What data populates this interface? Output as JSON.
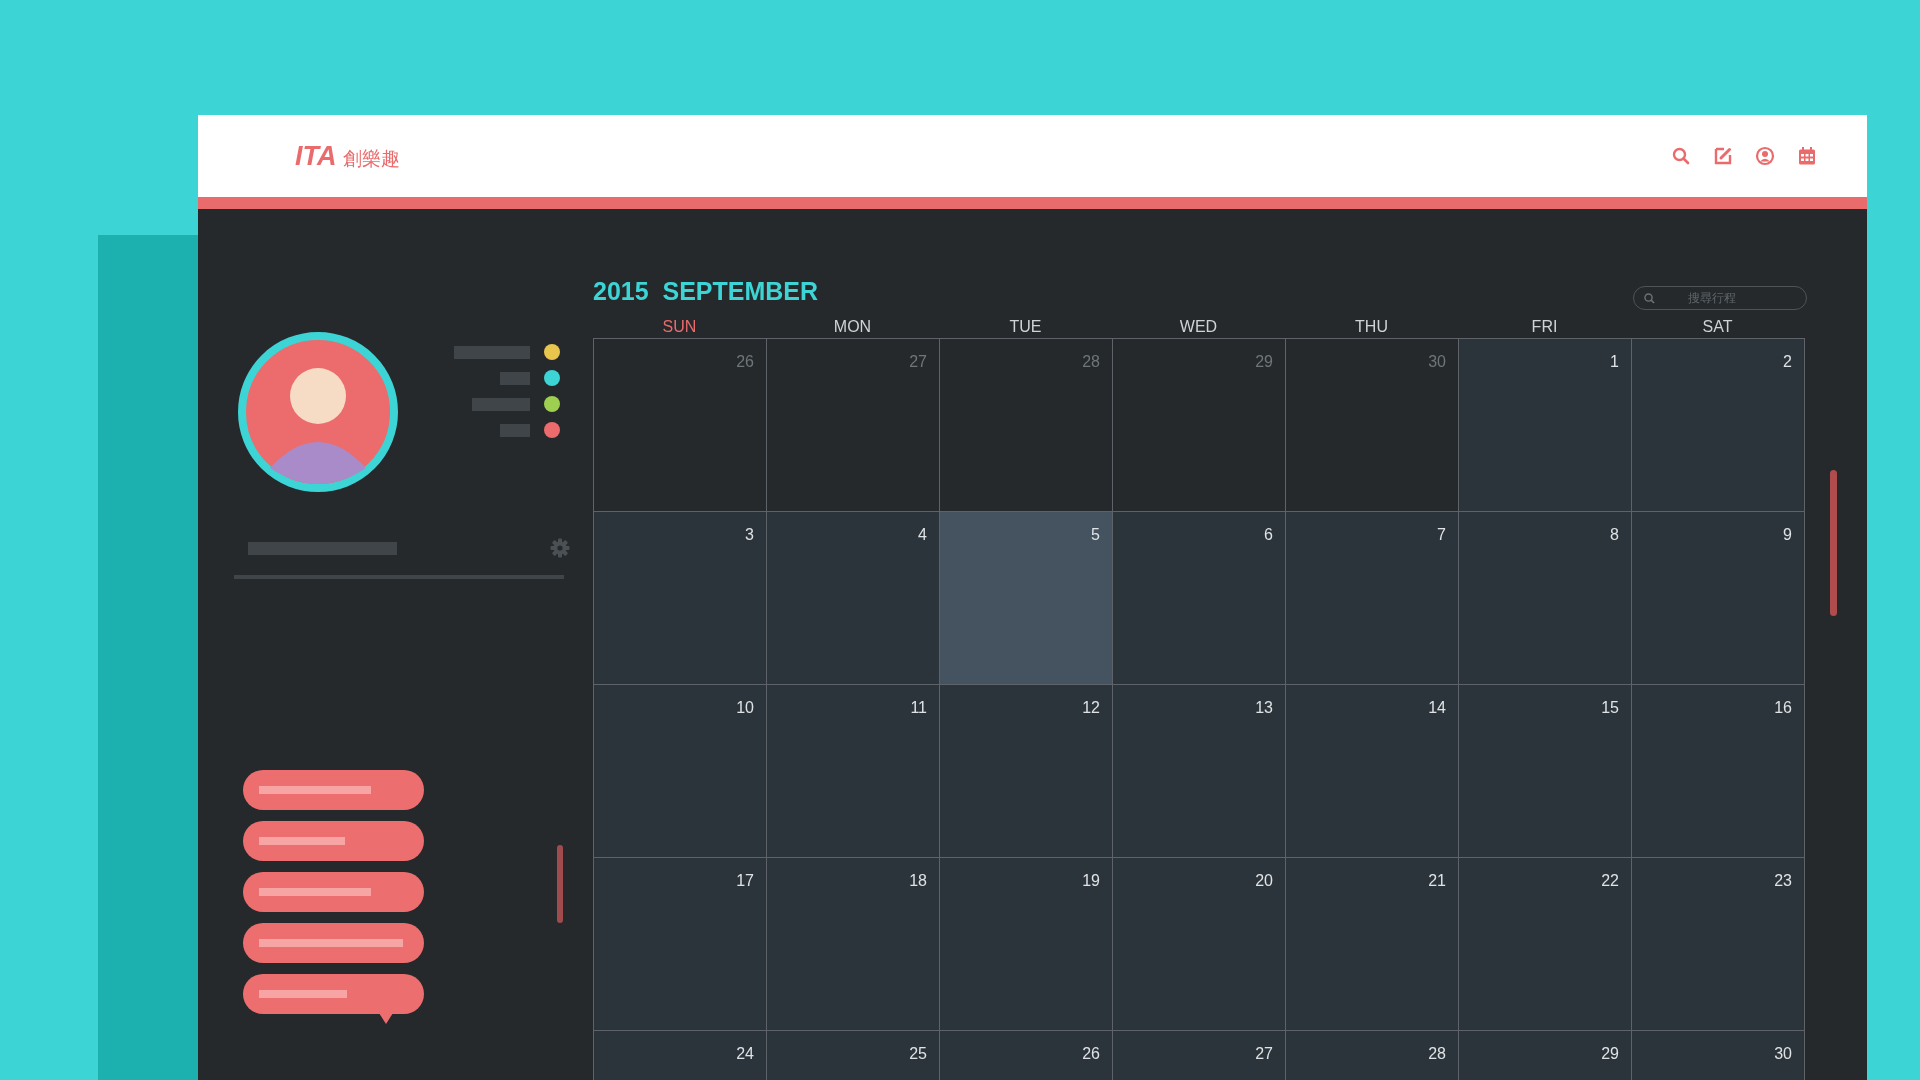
{
  "header": {
    "logo_mark": "ITA",
    "logo_text": "創樂趣"
  },
  "sidebar": {
    "legend": [
      {
        "color": "#e8c64e"
      },
      {
        "color": "#3dd4d6"
      },
      {
        "color": "#9fcf50"
      },
      {
        "color": "#ec6b6c"
      }
    ]
  },
  "calendar": {
    "year": "2015",
    "month": "SEPTEMBER",
    "search": {
      "placeholder": "搜尋行程"
    },
    "weekdays": [
      {
        "label": "SUN",
        "holiday": true
      },
      {
        "label": "MON",
        "holiday": false
      },
      {
        "label": "TUE",
        "holiday": false
      },
      {
        "label": "WED",
        "holiday": false
      },
      {
        "label": "THU",
        "holiday": false
      },
      {
        "label": "FRI",
        "holiday": false
      },
      {
        "label": "SAT",
        "holiday": false
      }
    ],
    "weeks": [
      [
        {
          "day": "26",
          "outside": true,
          "selected": false
        },
        {
          "day": "27",
          "outside": true,
          "selected": false
        },
        {
          "day": "28",
          "outside": true,
          "selected": false
        },
        {
          "day": "29",
          "outside": true,
          "selected": false
        },
        {
          "day": "30",
          "outside": true,
          "selected": false
        },
        {
          "day": "1",
          "outside": false,
          "selected": false
        },
        {
          "day": "2",
          "outside": false,
          "selected": false
        }
      ],
      [
        {
          "day": "3",
          "outside": false,
          "selected": false
        },
        {
          "day": "4",
          "outside": false,
          "selected": false
        },
        {
          "day": "5",
          "outside": false,
          "selected": true
        },
        {
          "day": "6",
          "outside": false,
          "selected": false
        },
        {
          "day": "7",
          "outside": false,
          "selected": false
        },
        {
          "day": "8",
          "outside": false,
          "selected": false
        },
        {
          "day": "9",
          "outside": false,
          "selected": false
        }
      ],
      [
        {
          "day": "10",
          "outside": false,
          "selected": false
        },
        {
          "day": "11",
          "outside": false,
          "selected": false
        },
        {
          "day": "12",
          "outside": false,
          "selected": false
        },
        {
          "day": "13",
          "outside": false,
          "selected": false
        },
        {
          "day": "14",
          "outside": false,
          "selected": false
        },
        {
          "day": "15",
          "outside": false,
          "selected": false
        },
        {
          "day": "16",
          "outside": false,
          "selected": false
        }
      ],
      [
        {
          "day": "17",
          "outside": false,
          "selected": false
        },
        {
          "day": "18",
          "outside": false,
          "selected": false
        },
        {
          "day": "19",
          "outside": false,
          "selected": false
        },
        {
          "day": "20",
          "outside": false,
          "selected": false
        },
        {
          "day": "21",
          "outside": false,
          "selected": false
        },
        {
          "day": "22",
          "outside": false,
          "selected": false
        },
        {
          "day": "23",
          "outside": false,
          "selected": false
        }
      ],
      [
        {
          "day": "24",
          "outside": false,
          "selected": false
        },
        {
          "day": "25",
          "outside": false,
          "selected": false
        },
        {
          "day": "26",
          "outside": false,
          "selected": false
        },
        {
          "day": "27",
          "outside": false,
          "selected": false
        },
        {
          "day": "28",
          "outside": false,
          "selected": false
        },
        {
          "day": "29",
          "outside": false,
          "selected": false
        },
        {
          "day": "30",
          "outside": false,
          "selected": false
        }
      ]
    ]
  }
}
